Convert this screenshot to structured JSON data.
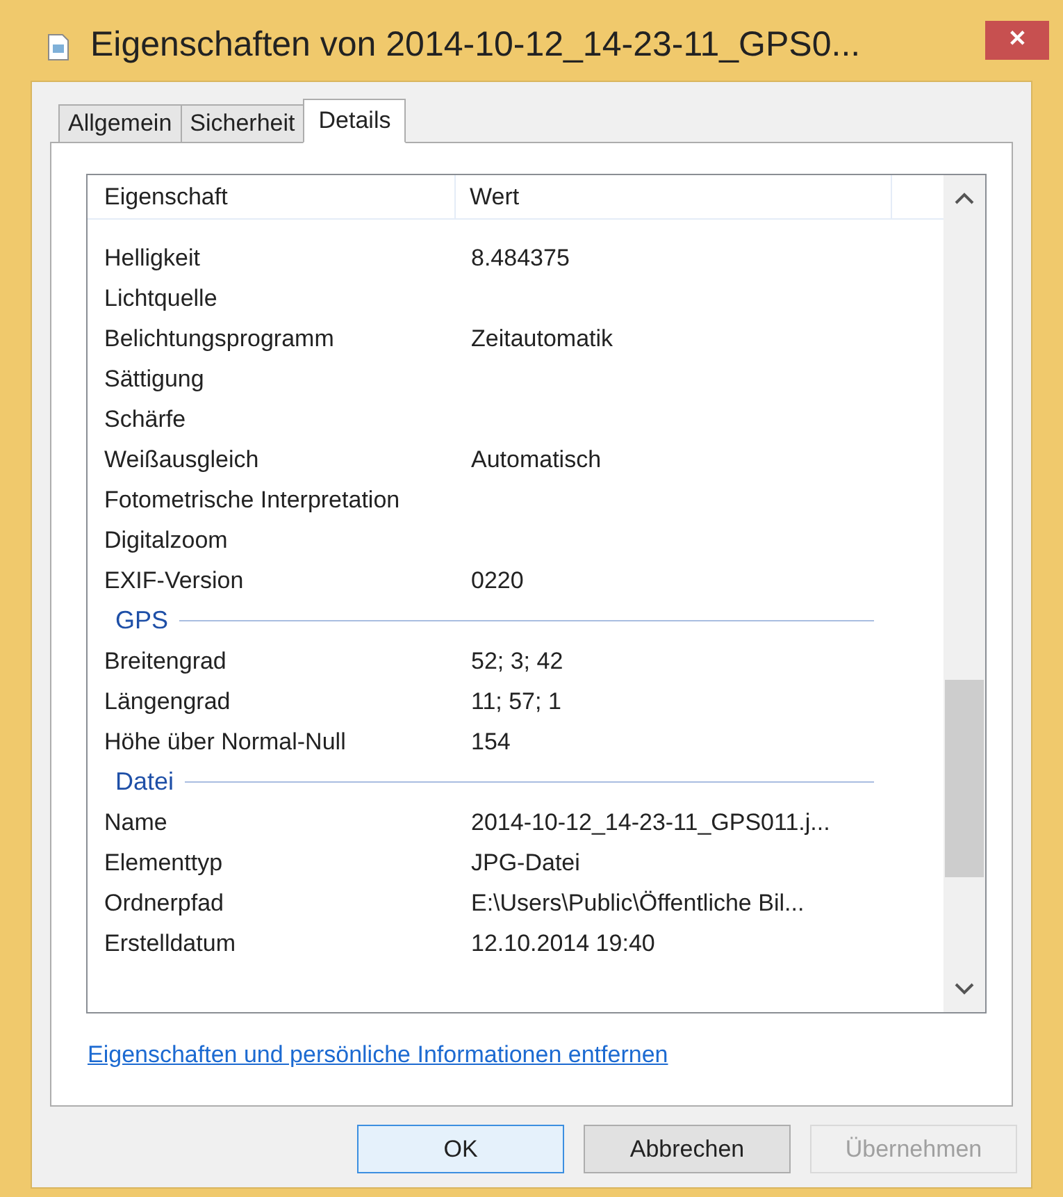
{
  "window": {
    "title": "Eigenschaften von 2014-10-12_14-23-11_GPS0...",
    "close": "✕"
  },
  "tabs": [
    {
      "label": "Allgemein",
      "selected": false
    },
    {
      "label": "Sicherheit",
      "selected": false
    },
    {
      "label": "Details",
      "selected": true
    }
  ],
  "table": {
    "columns": [
      "Eigenschaft",
      "Wert"
    ],
    "rows": [
      {
        "kind": "property",
        "name": "Helligkeit",
        "value": "8.484375"
      },
      {
        "kind": "property",
        "name": "Lichtquelle"
      },
      {
        "kind": "property",
        "name": "Belichtungsprogramm",
        "value": "Zeitautomatik"
      },
      {
        "kind": "property",
        "name": "Sättigung"
      },
      {
        "kind": "property",
        "name": "Schärfe"
      },
      {
        "kind": "property",
        "name": "Weißausgleich",
        "value": "Automatisch"
      },
      {
        "kind": "property",
        "name": "Fotometrische Interpretation"
      },
      {
        "kind": "property",
        "name": "Digitalzoom"
      },
      {
        "kind": "property",
        "name": "EXIF-Version",
        "value": "0220"
      },
      {
        "kind": "group",
        "name": "GPS"
      },
      {
        "kind": "property",
        "name": "Breitengrad",
        "value": "52; 3; 42"
      },
      {
        "kind": "property",
        "name": "Längengrad",
        "value": "11; 57; 1"
      },
      {
        "kind": "property",
        "name": "Höhe über Normal-Null",
        "value": "154"
      },
      {
        "kind": "group",
        "name": "Datei"
      },
      {
        "kind": "property",
        "name": "Name",
        "value": "2014-10-12_14-23-11_GPS011.j..."
      },
      {
        "kind": "property",
        "name": "Elementtyp",
        "value": "JPG-Datei"
      },
      {
        "kind": "property",
        "name": "Ordnerpfad",
        "value": "E:\\Users\\Public\\Öffentliche Bil..."
      },
      {
        "kind": "property",
        "name": "Erstelldatum",
        "value": "12.10.2014 19:40"
      }
    ]
  },
  "link": "Eigenschaften und persönliche Informationen entfernen",
  "buttons": [
    {
      "label": "OK",
      "default": true,
      "disabled": false
    },
    {
      "label": "Abbrechen",
      "default": false,
      "disabled": false
    },
    {
      "label": "Übernehmen",
      "default": false,
      "disabled": true
    }
  ]
}
